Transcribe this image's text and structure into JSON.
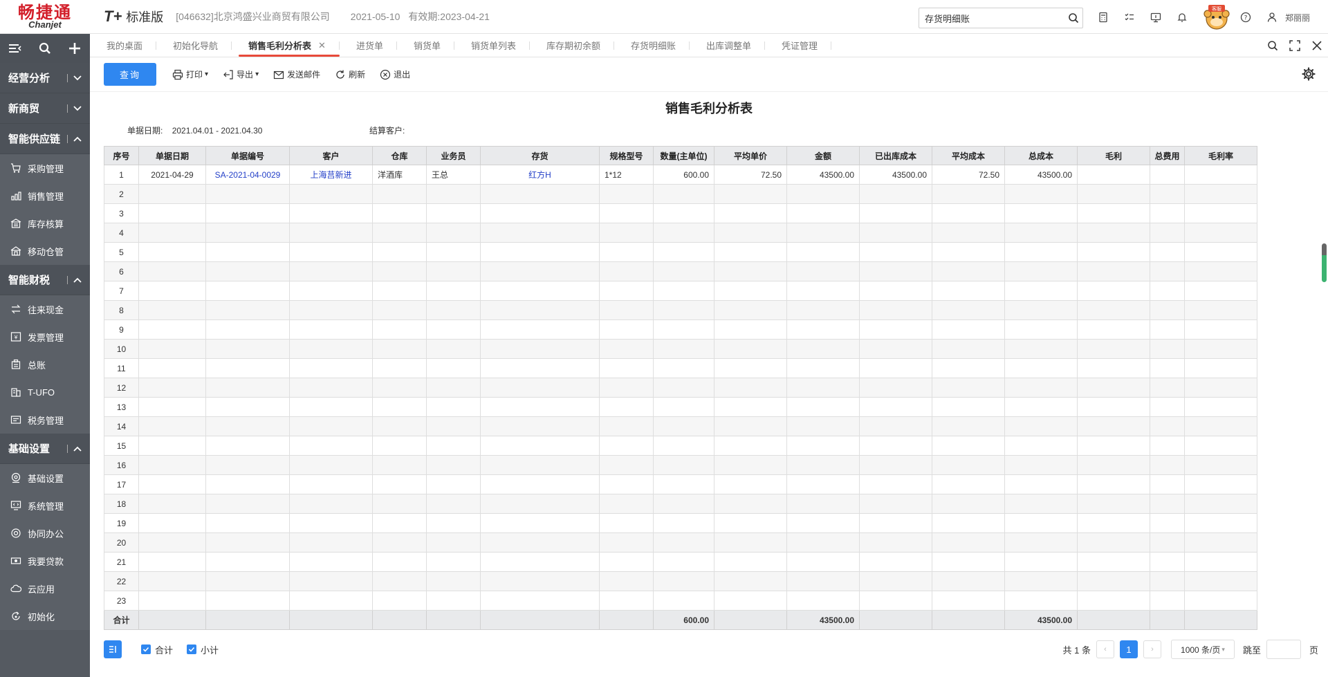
{
  "header": {
    "logo_cn": "畅捷通",
    "logo_en": "Chanjet",
    "product": "T+",
    "edition": "标准版",
    "company": "[046632]北京鸿盛兴业商贸有限公司",
    "date": "2021-05-10",
    "valid": "有效期:2023-04-21",
    "search_value": "存货明细账",
    "user": "郑丽丽",
    "mascot_label": "客服"
  },
  "sidebar": {
    "groups": [
      {
        "label": "经营分析",
        "expanded": false,
        "items": []
      },
      {
        "label": "新商贸",
        "expanded": false,
        "items": []
      },
      {
        "label": "智能供应链",
        "expanded": true,
        "items": [
          "采购管理",
          "销售管理",
          "库存核算",
          "移动仓管"
        ]
      },
      {
        "label": "智能财税",
        "expanded": true,
        "items": [
          "往来现金",
          "发票管理",
          "总账",
          "T-UFO",
          "税务管理"
        ]
      },
      {
        "label": "基础设置",
        "expanded": true,
        "items": [
          "基础设置",
          "系统管理",
          "协同办公",
          "我要贷款",
          "云应用",
          "初始化"
        ]
      }
    ]
  },
  "tabs": [
    {
      "label": "我的桌面",
      "active": false
    },
    {
      "label": "初始化导航",
      "active": false
    },
    {
      "label": "销售毛利分析表",
      "active": true
    },
    {
      "label": "进货单",
      "active": false
    },
    {
      "label": "销货单",
      "active": false
    },
    {
      "label": "销货单列表",
      "active": false
    },
    {
      "label": "库存期初余额",
      "active": false
    },
    {
      "label": "存货明细账",
      "active": false
    },
    {
      "label": "出库调整单",
      "active": false
    },
    {
      "label": "凭证管理",
      "active": false
    }
  ],
  "toolbar": {
    "query": "查询",
    "print": "打印",
    "export": "导出",
    "email": "发送邮件",
    "refresh": "刷新",
    "exit": "退出"
  },
  "report": {
    "title": "销售毛利分析表",
    "date_label": "单据日期:",
    "date_value": "2021.04.01 - 2021.04.30",
    "customer_label": "结算客户:",
    "customer_value": ""
  },
  "table": {
    "columns": [
      "序号",
      "单据日期",
      "单据编号",
      "客户",
      "仓库",
      "业务员",
      "存货",
      "规格型号",
      "数量(主单位)",
      "平均单价",
      "金额",
      "已出库成本",
      "平均成本",
      "总成本",
      "毛利",
      "总费用",
      "毛利率"
    ],
    "rows": [
      [
        "1",
        "2021-04-29",
        "SA-2021-04-0029",
        "上海莒新进",
        "洋酒库",
        "王总",
        "红方H",
        "1*12",
        "600.00",
        "72.50",
        "43500.00",
        "43500.00",
        "72.50",
        "43500.00",
        "",
        "",
        ""
      ],
      [
        "2",
        "",
        "",
        "",
        "",
        "",
        "",
        "",
        "",
        "",
        "",
        "",
        "",
        "",
        "",
        "",
        ""
      ],
      [
        "3",
        "",
        "",
        "",
        "",
        "",
        "",
        "",
        "",
        "",
        "",
        "",
        "",
        "",
        "",
        "",
        ""
      ],
      [
        "4",
        "",
        "",
        "",
        "",
        "",
        "",
        "",
        "",
        "",
        "",
        "",
        "",
        "",
        "",
        "",
        ""
      ],
      [
        "5",
        "",
        "",
        "",
        "",
        "",
        "",
        "",
        "",
        "",
        "",
        "",
        "",
        "",
        "",
        "",
        ""
      ],
      [
        "6",
        "",
        "",
        "",
        "",
        "",
        "",
        "",
        "",
        "",
        "",
        "",
        "",
        "",
        "",
        "",
        ""
      ],
      [
        "7",
        "",
        "",
        "",
        "",
        "",
        "",
        "",
        "",
        "",
        "",
        "",
        "",
        "",
        "",
        "",
        ""
      ],
      [
        "8",
        "",
        "",
        "",
        "",
        "",
        "",
        "",
        "",
        "",
        "",
        "",
        "",
        "",
        "",
        "",
        ""
      ],
      [
        "9",
        "",
        "",
        "",
        "",
        "",
        "",
        "",
        "",
        "",
        "",
        "",
        "",
        "",
        "",
        "",
        ""
      ],
      [
        "10",
        "",
        "",
        "",
        "",
        "",
        "",
        "",
        "",
        "",
        "",
        "",
        "",
        "",
        "",
        "",
        ""
      ],
      [
        "11",
        "",
        "",
        "",
        "",
        "",
        "",
        "",
        "",
        "",
        "",
        "",
        "",
        "",
        "",
        "",
        ""
      ],
      [
        "12",
        "",
        "",
        "",
        "",
        "",
        "",
        "",
        "",
        "",
        "",
        "",
        "",
        "",
        "",
        "",
        ""
      ],
      [
        "13",
        "",
        "",
        "",
        "",
        "",
        "",
        "",
        "",
        "",
        "",
        "",
        "",
        "",
        "",
        "",
        ""
      ],
      [
        "14",
        "",
        "",
        "",
        "",
        "",
        "",
        "",
        "",
        "",
        "",
        "",
        "",
        "",
        "",
        "",
        ""
      ],
      [
        "15",
        "",
        "",
        "",
        "",
        "",
        "",
        "",
        "",
        "",
        "",
        "",
        "",
        "",
        "",
        "",
        ""
      ],
      [
        "16",
        "",
        "",
        "",
        "",
        "",
        "",
        "",
        "",
        "",
        "",
        "",
        "",
        "",
        "",
        "",
        ""
      ],
      [
        "17",
        "",
        "",
        "",
        "",
        "",
        "",
        "",
        "",
        "",
        "",
        "",
        "",
        "",
        "",
        "",
        ""
      ],
      [
        "18",
        "",
        "",
        "",
        "",
        "",
        "",
        "",
        "",
        "",
        "",
        "",
        "",
        "",
        "",
        "",
        ""
      ],
      [
        "19",
        "",
        "",
        "",
        "",
        "",
        "",
        "",
        "",
        "",
        "",
        "",
        "",
        "",
        "",
        "",
        ""
      ],
      [
        "20",
        "",
        "",
        "",
        "",
        "",
        "",
        "",
        "",
        "",
        "",
        "",
        "",
        "",
        "",
        "",
        ""
      ],
      [
        "21",
        "",
        "",
        "",
        "",
        "",
        "",
        "",
        "",
        "",
        "",
        "",
        "",
        "",
        "",
        "",
        ""
      ],
      [
        "22",
        "",
        "",
        "",
        "",
        "",
        "",
        "",
        "",
        "",
        "",
        "",
        "",
        "",
        "",
        "",
        ""
      ],
      [
        "23",
        "",
        "",
        "",
        "",
        "",
        "",
        "",
        "",
        "",
        "",
        "",
        "",
        "",
        "",
        "",
        ""
      ]
    ],
    "total": [
      "合计",
      "",
      "",
      "",
      "",
      "",
      "",
      "",
      "600.00",
      "",
      "43500.00",
      "",
      "",
      "43500.00",
      "",
      "",
      ""
    ]
  },
  "footer": {
    "total_check": "合计",
    "subtotal_check": "小计",
    "count": "共 1 条",
    "prev": "‹",
    "current_page": "1",
    "next": "›",
    "page_size": "1000 条/页",
    "jump": "跳至",
    "page_suffix": "页"
  },
  "colors": {
    "primary": "#2f87f0",
    "sidebar_bg": "#555a61",
    "brand_red": "#d3202b",
    "link": "#2440c8",
    "tab_active": "#e84a3a"
  }
}
